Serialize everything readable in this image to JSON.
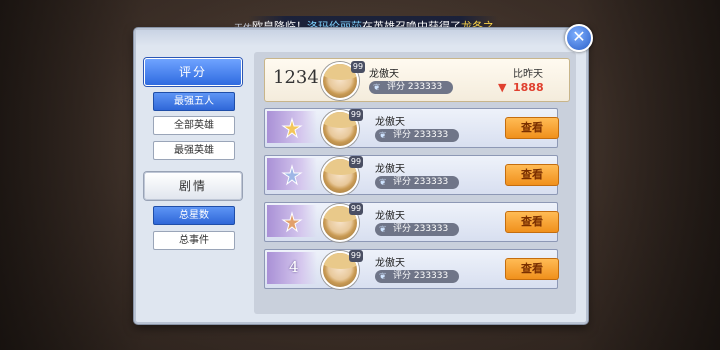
{
  "banner": {
    "prefix": "天依",
    "text_start": "欧皇降临！",
    "player": "洛玛伦丽莎",
    "text_mid": "在英雄召唤中获得了",
    "hero": "龙冬之"
  },
  "close_label": "✕",
  "left": {
    "category_score": "评分",
    "sub_top5": "最强五人",
    "sub_all": "全部英雄",
    "sub_strongest": "最强英雄",
    "category_story": "剧情",
    "sub_total_stars": "总星数",
    "sub_total_events": "总事件"
  },
  "my_row": {
    "rank": "1234",
    "level": "99",
    "name": "龙傲天",
    "score": "评分 233333",
    "compare_label": "比昨天",
    "compare_value": "1888"
  },
  "rows": [
    {
      "rank": "",
      "emblem": "gold-laurel-icon",
      "level": "99",
      "name": "龙傲天",
      "score": "评分 233333",
      "button": "查看"
    },
    {
      "rank": "",
      "emblem": "silver-laurel-icon",
      "level": "99",
      "name": "龙傲天",
      "score": "评分 233333",
      "button": "查看"
    },
    {
      "rank": "",
      "emblem": "bronze-laurel-icon",
      "level": "99",
      "name": "龙傲天",
      "score": "评分 233333",
      "button": "查看"
    },
    {
      "rank": "4",
      "emblem": "",
      "level": "99",
      "name": "龙傲天",
      "score": "评分 233333",
      "button": "查看"
    }
  ]
}
